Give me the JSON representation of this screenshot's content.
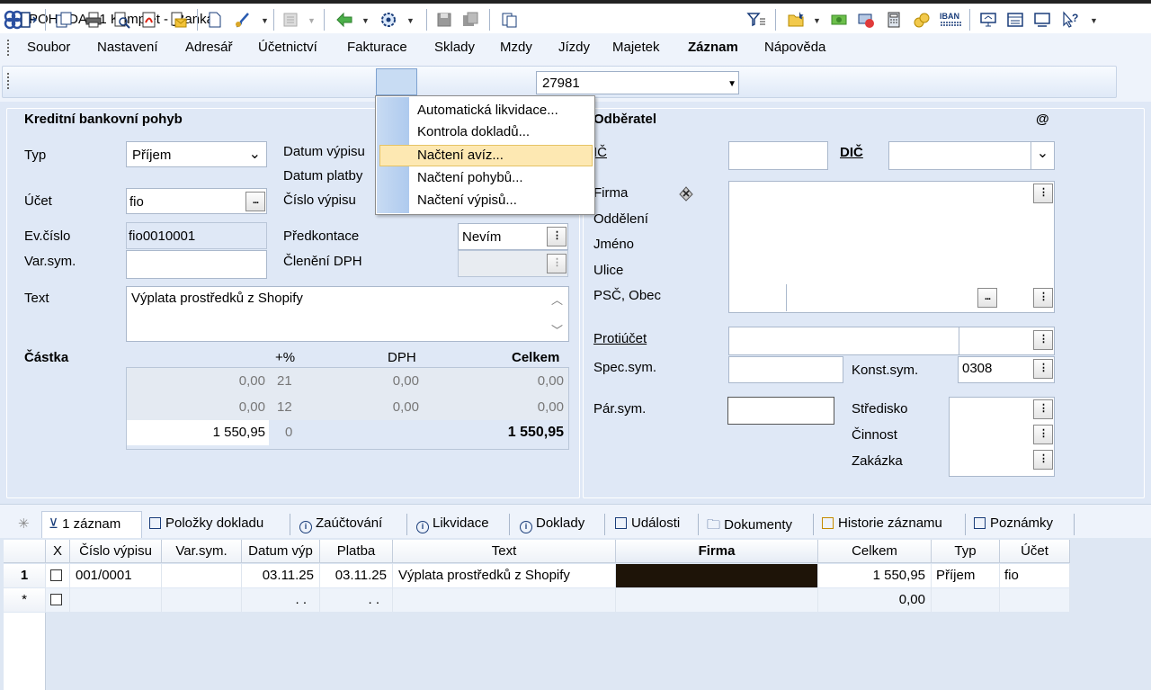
{
  "window": {
    "title": "POHODA E1 Komplet - [Banka]"
  },
  "menu": [
    "Soubor",
    "Nastavení",
    "Adresář",
    "Účetnictví",
    "Fakturace",
    "Sklady",
    "Mzdy",
    "Jízdy",
    "Majetek",
    "Záznam",
    "Nápověda"
  ],
  "toolbar": {
    "record_value": "27981"
  },
  "context_menu": [
    "Automatická likvidace...",
    "Kontrola dokladů...",
    "Načtení avíz...",
    "Načtení pohybů...",
    "Načtení výpisů..."
  ],
  "left": {
    "header": "Kreditní bankovní pohyb",
    "typ_label": "Typ",
    "typ_value": "Příjem",
    "ucet_label": "Účet",
    "ucet_value": "fio",
    "datum_vypisu_label": "Datum výpisu",
    "datum_platby_label": "Datum platby",
    "cislo_vypisu_label": "Číslo výpisu",
    "evcislo_label": "Ev.číslo",
    "evcislo_value": "fio0010001",
    "varsym_label": "Var.sym.",
    "predkontace_label": "Předkontace",
    "predkontace_value": "Nevím",
    "cleneni_label": "Členění DPH",
    "text_label": "Text",
    "text_value": "Výplata prostředků z Shopify",
    "castka_label": "Částka",
    "pct_label": "+%",
    "dph_label": "DPH",
    "celkem_label": "Celkem",
    "rows": [
      {
        "base": "0,00",
        "pct": "21",
        "dph": "0,00",
        "total": "0,00"
      },
      {
        "base": "0,00",
        "pct": "12",
        "dph": "0,00",
        "total": "0,00"
      },
      {
        "base": "1 550,95",
        "pct": "0",
        "total": "1 550,95"
      }
    ]
  },
  "right": {
    "header": "Odběratel",
    "at": "@",
    "ic_label": "IČ",
    "dic_label": "DIČ",
    "firma_label": "Firma",
    "oddeleni_label": "Oddělení",
    "jmeno_label": "Jméno",
    "ulice_label": "Ulice",
    "psc_label": "PSČ, Obec",
    "protiucet_label": "Protiúčet",
    "specsym_label": "Spec.sym.",
    "konstsym_label": "Konst.sym.",
    "konstsym_value": "0308",
    "parsym_label": "Pár.sym.",
    "stredisko_label": "Středisko",
    "cinnost_label": "Činnost",
    "zakazka_label": "Zakázka",
    "ellipsis": "...",
    "ellipsis_v": "⋮"
  },
  "tabs": [
    "1 záznam",
    "Položky dokladu",
    "Zaúčtování",
    "Likvidace",
    "Doklady",
    "Události",
    "Dokumenty",
    "Historie záznamu",
    "Poznámky"
  ],
  "tabs_star": "✳",
  "grid": {
    "headers": [
      "X",
      "Číslo výpisu",
      "Var.sym.",
      "Datum výp",
      "Platba",
      "Text",
      "Firma",
      "Celkem",
      "Typ",
      "Účet"
    ],
    "row1": {
      "marker": "1",
      "cislo": "001/0001",
      "datum": "03.11.25",
      "platba": "03.11.25",
      "text": "Výplata prostředků z Shopify",
      "celkem": "1 550,95",
      "typ": "Příjem",
      "ucet": "fio"
    },
    "row2": {
      "marker": "*",
      "datum": ". .",
      "platba": ". .",
      "celkem": "0,00"
    }
  },
  "colors": {
    "accent": "#1a3d7a",
    "form_bg": "#dfe8f6",
    "highlight": "#fde8b2"
  }
}
